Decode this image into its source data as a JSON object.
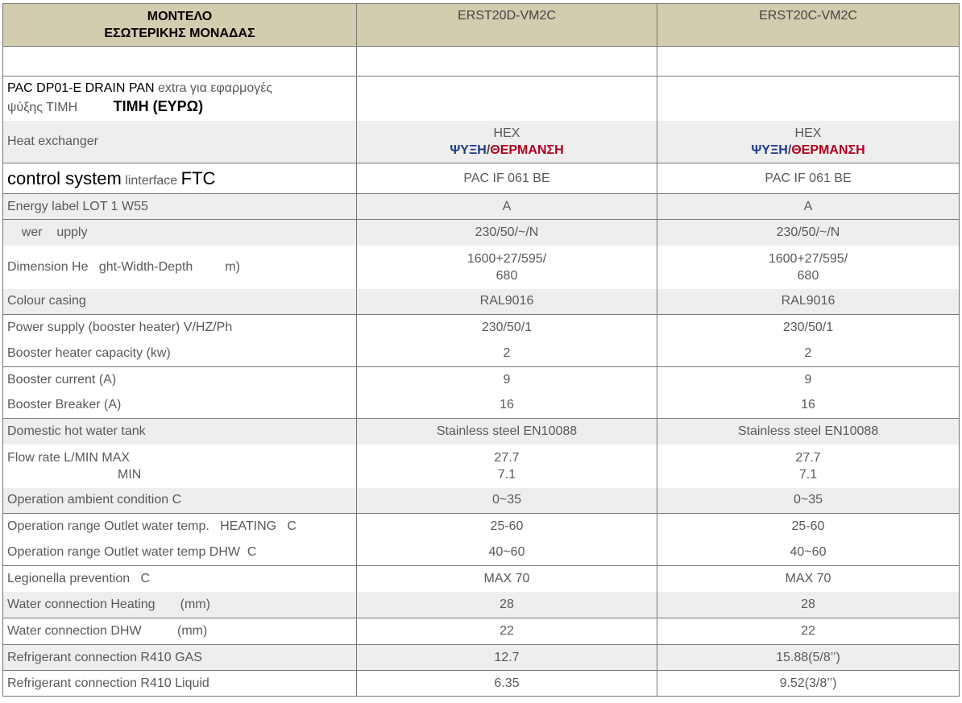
{
  "header": {
    "label_line1": "ΜΟΝΤΕΛΟ",
    "label_line2": "ΕΣΩΤΕΡΙΚΗΣ ΜΟΝΑΔΑΣ",
    "model_1": "ERST20D-VM2C",
    "model_2": "ERST20C-VM2C"
  },
  "drain_pan": {
    "code": "PAC DP01-E  DRAIN PAN",
    "extra": " extra για  εφαρμογές",
    "line2": "ψύξης   ΤΙΜΗ",
    "price_label": "ΤΙΜΗ (ΕΥΡΩ)"
  },
  "heat_exchanger": {
    "label": "Heat exchanger",
    "hex": "HEX",
    "cooling": "ΨΥΞΗ",
    "slash": "/",
    "heating": "ΘΕΡΜΑΝΣΗ"
  },
  "control": {
    "label_a": "control system",
    "label_b": " linterface  ",
    "label_c": "FTC",
    "value_1": "PAC IF 061 BE",
    "value_2": "PAC IF 061 BE"
  },
  "rows": {
    "energy": {
      "label": "Energy label  LOT 1 W55",
      "v1": "A",
      "v2": "A"
    },
    "power": {
      "label": "    wer    upply",
      "v1": "230/50/~/N",
      "v2": "230/50/~/N"
    },
    "dimension": {
      "label": "Dimension He   ght-Width-Depth         m)",
      "v1a": "1600+27/595/",
      "v1b": "680",
      "v2a": "1600+27/595/",
      "v2b": "680"
    },
    "colour": {
      "label": "Colour casing",
      "v1": "RAL9016",
      "v2": "RAL9016"
    },
    "booster_ps": {
      "label": "Power supply (booster heater) V/HZ/Ph",
      "v1": "230/50/1",
      "v2": "230/50/1"
    },
    "booster_cap": {
      "label": "Booster heater capacity (kw)",
      "v1": "2",
      "v2": "2"
    },
    "booster_cur": {
      "label": "Booster current (A)",
      "v1": "9",
      "v2": "9"
    },
    "booster_brk": {
      "label": "Booster Breaker (A)",
      "v1": "16",
      "v2": "16"
    },
    "dhw_tank": {
      "label": "Domestic hot water tank",
      "v1": "Stainless steel  EN10088",
      "v2": "Stainless steel  EN10088"
    },
    "flow": {
      "label_a": "Flow rate L/MIN  MAX",
      "label_b": "MIN",
      "v1a": "27.7",
      "v1b": "7.1",
      "v2a": "27.7",
      "v2b": "7.1"
    },
    "ambient": {
      "label": "Operation ambient condition  C",
      "v1": "0~35",
      "v2": "0~35"
    },
    "range_heat": {
      "label": "Operation range Outlet water temp.   HEATING   C",
      "v1": "25-60",
      "v2": "25-60"
    },
    "range_dhw": {
      "label": "Operation range Outlet water temp DHW  C",
      "v1": "40~60",
      "v2": "40~60"
    },
    "legionella": {
      "label": "Legionella prevention   C",
      "v1": "MAX 70",
      "v2": "MAX 70"
    },
    "wc_heating": {
      "label": "Water connection Heating       (mm)",
      "v1": "28",
      "v2": "28"
    },
    "wc_dhw": {
      "label": "Water connection DHW          (mm)",
      "v1": "22",
      "v2": "22"
    },
    "ref_gas": {
      "label": "Refrigerant connection R410 GAS",
      "v1": "12.7",
      "v2": "15.88(5/8’’)"
    },
    "ref_liquid": {
      "label": "Refrigerant connection R410 Liquid",
      "v1": "6.35",
      "v2": "9.52(3/8’’)"
    }
  }
}
